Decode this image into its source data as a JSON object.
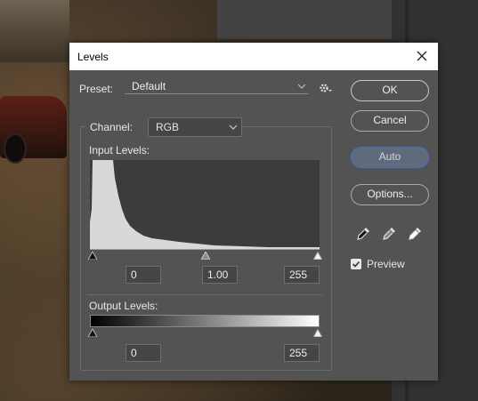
{
  "dialog": {
    "title": "Levels",
    "preset_label": "Preset:",
    "preset_value": "Default",
    "channel_label": "Channel:",
    "channel_value": "RGB",
    "input_levels_label": "Input Levels:",
    "input_black": "0",
    "input_gamma": "1.00",
    "input_white": "255",
    "output_levels_label": "Output Levels:",
    "output_black": "0",
    "output_white": "255"
  },
  "buttons": {
    "ok": "OK",
    "cancel": "Cancel",
    "auto": "Auto",
    "options": "Options..."
  },
  "preview": {
    "label": "Preview",
    "checked": true
  },
  "icons": [
    "close-icon",
    "chevron-down-icon",
    "gear-icon",
    "black-eyedropper-icon",
    "gray-eyedropper-icon",
    "white-eyedropper-icon",
    "slider-handle-icon",
    "checkbox-icon"
  ],
  "colors": {
    "dialog_bg": "#535353",
    "auto_accent": "#4a70c6",
    "histogram_fill": "#d8d8d8"
  }
}
